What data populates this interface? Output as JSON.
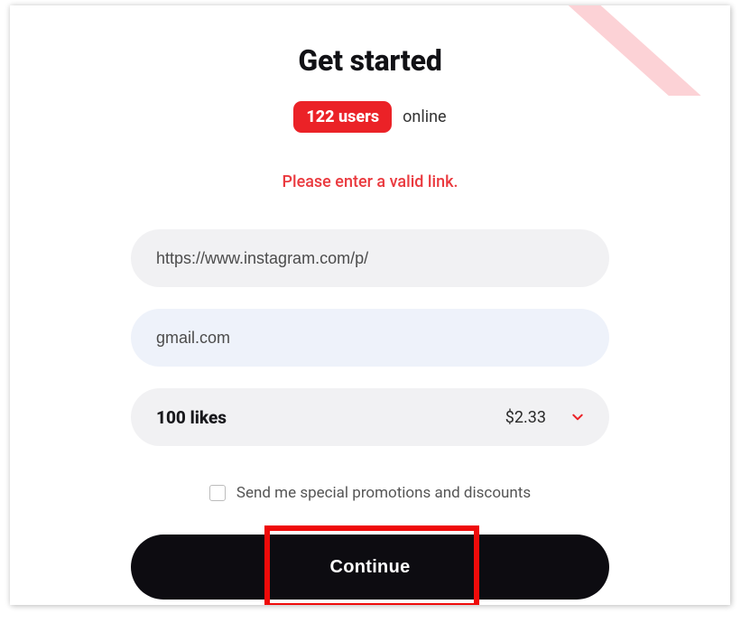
{
  "header": {
    "title": "Get started",
    "users_badge": "122 users",
    "online_label": "online"
  },
  "error_message": "Please enter a valid link.",
  "form": {
    "link_value": "https://www.instagram.com/p/",
    "email_value": "gmail.com",
    "product": {
      "label": "100 likes",
      "price": "$2.33"
    },
    "promo_checkbox_label": "Send me special promotions and discounts"
  },
  "actions": {
    "continue_label": "Continue"
  },
  "colors": {
    "accent_red": "#eb2227",
    "black": "#0d0c11"
  }
}
